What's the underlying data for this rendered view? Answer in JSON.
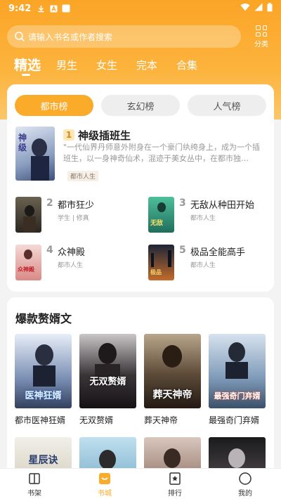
{
  "status_bar": {
    "time": "9:42"
  },
  "search": {
    "placeholder": "请输入书名或作者搜索"
  },
  "category_button": {
    "label": "分类"
  },
  "tabs": [
    {
      "label": "精选",
      "active": true
    },
    {
      "label": "男生"
    },
    {
      "label": "女生"
    },
    {
      "label": "完本"
    },
    {
      "label": "合集"
    }
  ],
  "ranking": {
    "tabs": [
      {
        "label": "都市榜",
        "active": true
      },
      {
        "label": "玄幻榜"
      },
      {
        "label": "人气榜"
      }
    ],
    "top_book": {
      "rank": "1",
      "title": "神级插班生",
      "desc": "\"一代仙界丹师意外附身在一个豪门纨绔身上，成为一个插班生，以一身神奇仙术，混迹于美女丛中，在都市独…",
      "tag": "都市人生",
      "cover_text": "神级插班生"
    },
    "books": [
      {
        "rank": "2",
        "title": "都市狂少",
        "sub": "学生 | 修真",
        "cover_text": "都市狂少"
      },
      {
        "rank": "3",
        "title": "无敌从种田开始",
        "sub": "都市人生",
        "cover_text": "无敌从种田开始"
      },
      {
        "rank": "4",
        "title": "众神殿",
        "sub": "都市人生",
        "cover_text": "众神殿"
      },
      {
        "rank": "5",
        "title": "极品全能高手",
        "sub": "都市人生",
        "cover_text": "极品全能高手"
      }
    ]
  },
  "section": {
    "title": "爆款赘婿文",
    "books": [
      {
        "title": "都市医神狂婿",
        "cover_text": "医神狂婿"
      },
      {
        "title": "无双赘婿",
        "cover_text": "无双赘婿"
      },
      {
        "title": "葬天神帝",
        "cover_text": "葬天神帝"
      },
      {
        "title": "最强奇门弃婿",
        "cover_text": "最强奇门弃婿"
      }
    ],
    "second_row": [
      {
        "cover_text": "星辰诀"
      },
      {
        "cover_text": ""
      },
      {
        "cover_text": ""
      },
      {
        "cover_text": ""
      }
    ]
  },
  "bottom_nav": [
    {
      "label": "书架",
      "icon": "book-icon"
    },
    {
      "label": "书城",
      "icon": "store-icon",
      "active": true
    },
    {
      "label": "排行",
      "icon": "ranking-icon"
    },
    {
      "label": "我的",
      "icon": "profile-icon"
    }
  ],
  "colors": {
    "accent": "#fbab2a",
    "header_top": "#fba526",
    "header_bottom": "#fbc66b"
  }
}
